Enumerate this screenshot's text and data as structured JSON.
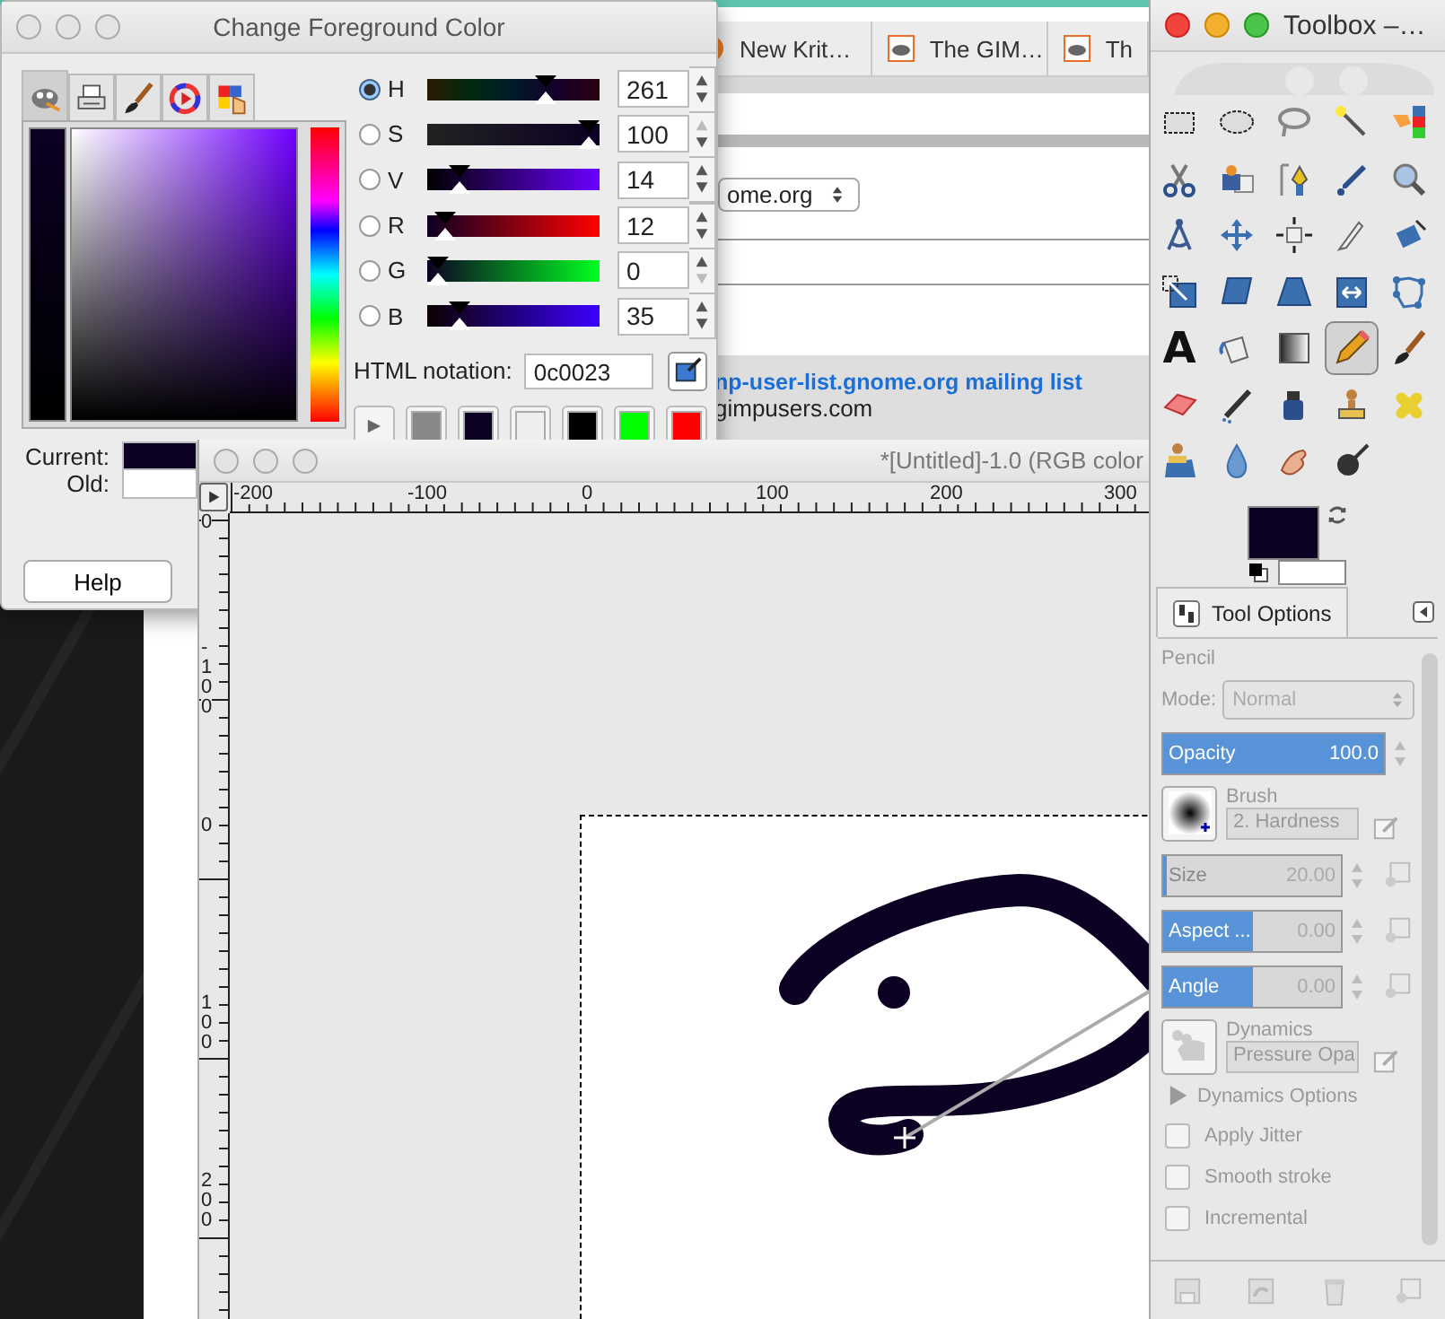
{
  "browser": {
    "tabs": [
      {
        "label": "New Krit…"
      },
      {
        "label": "The GIM…"
      },
      {
        "label": "Th"
      }
    ],
    "select_value": "ome.org",
    "link": "np-user-list.gnome.org mailing list",
    "text": "gimpusers.com"
  },
  "color_dialog": {
    "title": "Change Foreground Color",
    "tabs": [
      {
        "selected": true
      },
      {
        "selected": false
      },
      {
        "selected": false
      },
      {
        "selected": false
      },
      {
        "selected": false
      }
    ],
    "channels": [
      {
        "label": "H",
        "value": "261",
        "level": 0.72,
        "selected": true,
        "up_disabled": false,
        "down_disabled": false
      },
      {
        "label": "S",
        "value": "100",
        "level": 1,
        "selected": false,
        "up_disabled": true,
        "down_disabled": false
      },
      {
        "label": "V",
        "value": "14",
        "level": 0.14,
        "selected": false,
        "up_disabled": false,
        "down_disabled": false
      },
      {
        "label": "R",
        "value": "12",
        "level": 0.05,
        "selected": false,
        "up_disabled": false,
        "down_disabled": false
      },
      {
        "label": "G",
        "value": "0",
        "level": 0,
        "selected": false,
        "up_disabled": false,
        "down_disabled": true
      },
      {
        "label": "B",
        "value": "35",
        "level": 0.14,
        "selected": false,
        "up_disabled": false,
        "down_disabled": false
      }
    ],
    "html_label": "HTML notation:",
    "html_value": "0c0023",
    "history": [
      {
        "color": "#888888"
      },
      {
        "color": "#0c0023"
      },
      {
        "color": "#eeeeee"
      },
      {
        "color": "#000000"
      },
      {
        "color": "#00ff00"
      },
      {
        "color": "#ff0000"
      }
    ],
    "compare": [
      {
        "label": "Current:",
        "color": "#0c0023"
      },
      {
        "label": "Old:",
        "color": "#ffffff"
      }
    ],
    "help": "Help"
  },
  "canvas_window": {
    "title": "*[Untitled]-1.0 (RGB color",
    "h_ruler": [
      "-200",
      "-100",
      "0",
      "100",
      "200",
      "300"
    ],
    "v_ruler": [
      "0",
      "-100",
      "0",
      "100",
      "200"
    ]
  },
  "toolbox": {
    "title": "Toolbox –…",
    "tools": [
      {
        "selected": false
      },
      {
        "selected": false
      },
      {
        "selected": false
      },
      {
        "selected": false
      },
      {
        "selected": false
      },
      {
        "selected": false
      },
      {
        "selected": false
      },
      {
        "selected": false
      },
      {
        "selected": false
      },
      {
        "selected": false
      },
      {
        "selected": false
      },
      {
        "selected": false
      },
      {
        "selected": false
      },
      {
        "selected": false
      },
      {
        "selected": false
      },
      {
        "selected": false
      },
      {
        "selected": false
      },
      {
        "selected": false
      },
      {
        "selected": false
      },
      {
        "selected": false
      },
      {
        "selected": false,
        "glyph": "A"
      },
      {
        "selected": false
      },
      {
        "selected": false
      },
      {
        "selected": true
      },
      {
        "selected": false
      },
      {
        "selected": false
      },
      {
        "selected": false
      },
      {
        "selected": false
      },
      {
        "selected": false
      },
      {
        "selected": false
      },
      {
        "selected": false
      },
      {
        "selected": false
      },
      {
        "selected": false
      },
      {
        "selected": false
      }
    ],
    "swatches": [
      {
        "kind": "foreground",
        "color": "#0c0023"
      },
      {
        "kind": "background",
        "color": "#ffffff"
      }
    ]
  },
  "tool_options": {
    "tab": "Tool Options",
    "tool": "Pencil",
    "mode": {
      "label": "Mode:",
      "value": "Normal",
      "disabled": true
    },
    "opacity": {
      "label": "Opacity",
      "value": "100.0",
      "level": 1,
      "disabled": false
    },
    "brush": {
      "label": "Brush",
      "value": "2. Hardness"
    },
    "brush_sliders": [
      {
        "label": "Size",
        "value": "20.00",
        "level": 0.02,
        "disabled": true
      },
      {
        "label": "Aspect ...",
        "value": "0.00",
        "level": 0.5,
        "disabled": true
      },
      {
        "label": "Angle",
        "value": "0.00",
        "level": 0.5,
        "disabled": true
      }
    ],
    "dynamics": {
      "label": "Dynamics",
      "value": "Pressure Opa"
    },
    "expander": {
      "label": "Dynamics Options",
      "expanded": false
    },
    "checkboxes": [
      {
        "label": "Apply Jitter",
        "checked": false
      },
      {
        "label": "Smooth stroke",
        "checked": false
      },
      {
        "label": "Incremental",
        "checked": false
      }
    ]
  }
}
